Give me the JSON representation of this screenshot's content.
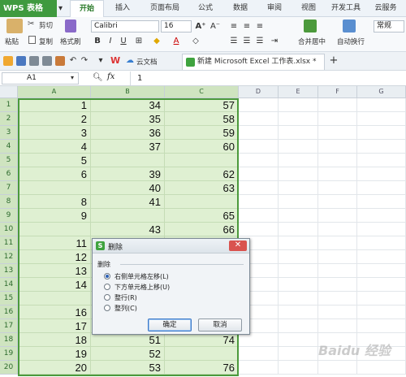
{
  "app": {
    "name": "WPS 表格"
  },
  "menu": {
    "tabs": [
      "开始",
      "插入",
      "页面布局",
      "公式",
      "数据",
      "审阅",
      "视图",
      "开发工具",
      "云服务"
    ],
    "active": "开始"
  },
  "ribbon": {
    "cut": "剪切",
    "paste": "粘贴",
    "copy": "复制",
    "format_painter": "格式刷",
    "font_name": "Calibri",
    "font_size": "16",
    "bold": "B",
    "italic": "I",
    "underline": "U",
    "merge_center": "合并居中",
    "wrap_text": "自动换行",
    "number_format": "常规"
  },
  "quickbar": {
    "cloud_doc": "云文档",
    "doc_tab": "新建 Microsoft Excel 工作表.xlsx *",
    "add_tab": "+"
  },
  "formula_bar": {
    "name_box": "A1",
    "fx": "fx",
    "value": "1"
  },
  "columns": [
    "A",
    "B",
    "C",
    "D",
    "E",
    "F",
    "G"
  ],
  "rows": [
    {
      "n": "1",
      "a": "1",
      "b": "34",
      "c": "57"
    },
    {
      "n": "2",
      "a": "2",
      "b": "35",
      "c": "58"
    },
    {
      "n": "3",
      "a": "3",
      "b": "36",
      "c": "59"
    },
    {
      "n": "4",
      "a": "4",
      "b": "37",
      "c": "60"
    },
    {
      "n": "5",
      "a": "5",
      "b": "",
      "c": ""
    },
    {
      "n": "6",
      "a": "6",
      "b": "39",
      "c": "62"
    },
    {
      "n": "7",
      "a": "",
      "b": "40",
      "c": "63"
    },
    {
      "n": "8",
      "a": "8",
      "b": "41",
      "c": ""
    },
    {
      "n": "9",
      "a": "9",
      "b": "",
      "c": "65"
    },
    {
      "n": "10",
      "a": "",
      "b": "43",
      "c": "66"
    },
    {
      "n": "11",
      "a": "11",
      "b": "",
      "c": ""
    },
    {
      "n": "12",
      "a": "12",
      "b": "",
      "c": ""
    },
    {
      "n": "13",
      "a": "13",
      "b": "",
      "c": ""
    },
    {
      "n": "14",
      "a": "14",
      "b": "",
      "c": ""
    },
    {
      "n": "15",
      "a": "",
      "b": "",
      "c": ""
    },
    {
      "n": "16",
      "a": "16",
      "b": "",
      "c": ""
    },
    {
      "n": "17",
      "a": "17",
      "b": "",
      "c": ""
    },
    {
      "n": "18",
      "a": "18",
      "b": "51",
      "c": "74"
    },
    {
      "n": "19",
      "a": "19",
      "b": "52",
      "c": ""
    },
    {
      "n": "20",
      "a": "20",
      "b": "53",
      "c": "76"
    }
  ],
  "dialog": {
    "title": "删除",
    "group": "删除",
    "options": [
      "右侧单元格左移(L)",
      "下方单元格上移(U)",
      "整行(R)",
      "整列(C)"
    ],
    "selected_index": 0,
    "ok": "确定",
    "cancel": "取消",
    "close": "✕"
  },
  "watermark": "Baidu 经验",
  "colors": {
    "accent": "#4c9a3c",
    "selection_fill": "#dff0d2",
    "header_selected": "#cfe4c0"
  }
}
